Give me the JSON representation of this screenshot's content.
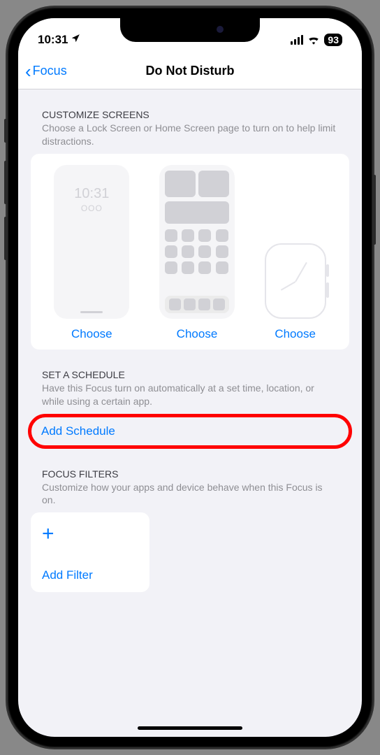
{
  "status": {
    "time": "10:31",
    "battery": "93"
  },
  "nav": {
    "back": "Focus",
    "title": "Do Not Disturb"
  },
  "customize": {
    "title": "CUSTOMIZE SCREENS",
    "desc": "Choose a Lock Screen or Home Screen page to turn on to help limit distractions.",
    "lock_time": "10:31",
    "lock_circles": "OOO",
    "choose_lock": "Choose",
    "choose_home": "Choose",
    "choose_watch": "Choose"
  },
  "schedule": {
    "title": "SET A SCHEDULE",
    "desc": "Have this Focus turn on automatically at a set time, location, or while using a certain app.",
    "add": "Add Schedule"
  },
  "filters": {
    "title": "FOCUS FILTERS",
    "desc": "Customize how your apps and device behave when this Focus is on.",
    "add": "Add Filter"
  }
}
